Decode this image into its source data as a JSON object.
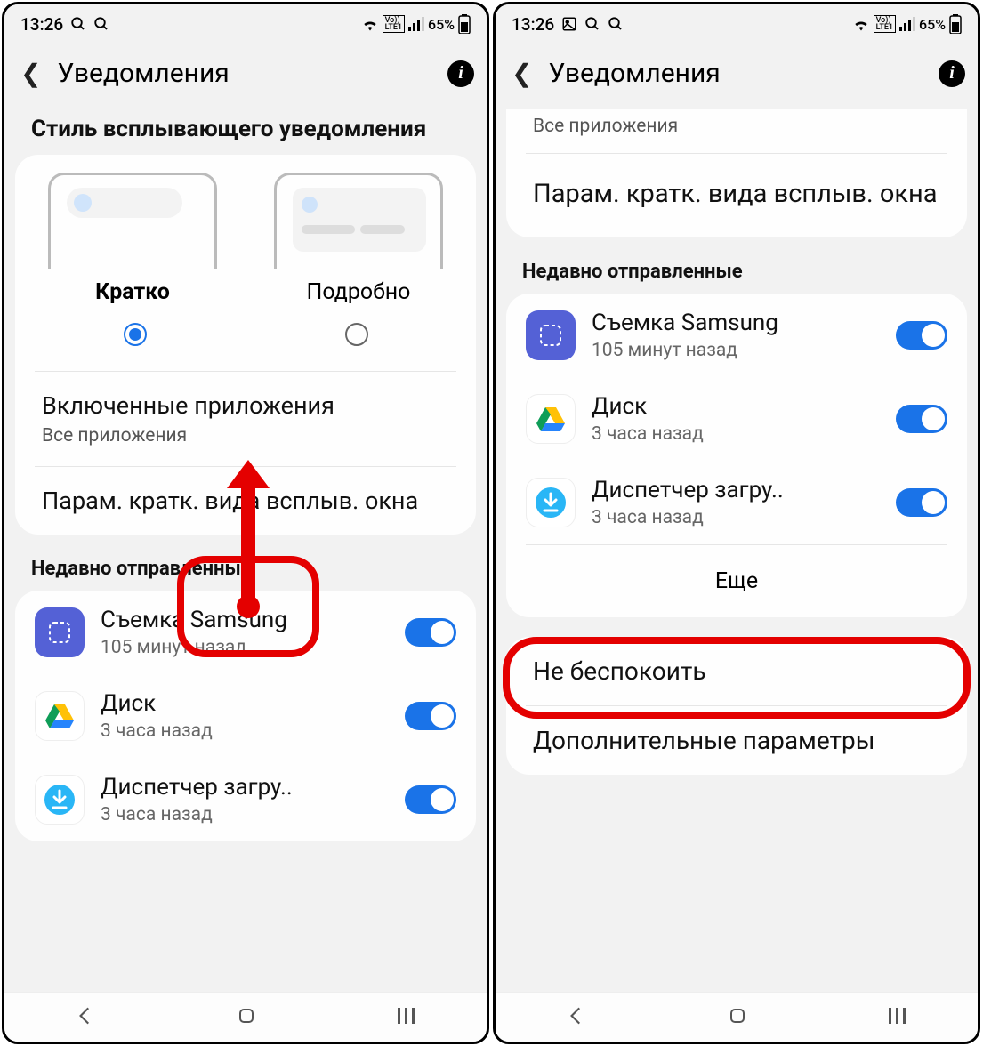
{
  "statusbar": {
    "time": "13:26",
    "battery": "65%",
    "volte": "Vo LTE",
    "gallery_icon": "gallery"
  },
  "header": {
    "title": "Уведомления"
  },
  "left": {
    "popup_style_header": "Стиль всплывающего уведомления",
    "style_options": [
      {
        "label": "Кратко",
        "selected": true
      },
      {
        "label": "Подробно",
        "selected": false
      }
    ],
    "included_apps": {
      "title": "Включенные приложения",
      "sub": "Все приложения"
    },
    "brief_settings": "Парам. кратк. вида всплыв. окна",
    "recent_header": "Недавно отправленные",
    "recent": [
      {
        "name": "Съемка Samsung",
        "time": "105 минут назад",
        "icon": "samsung",
        "on": true
      },
      {
        "name": "Диск",
        "time": "3 часа назад",
        "icon": "drive",
        "on": true
      },
      {
        "name": "Диспетчер загру..",
        "time": "3 часа назад",
        "icon": "download",
        "on": true
      }
    ]
  },
  "right": {
    "all_apps": "Все приложения",
    "brief_settings": "Парам. кратк. вида всплыв. окна",
    "recent_header": "Недавно отправленные",
    "recent": [
      {
        "name": "Съемка Samsung",
        "time": "105 минут назад",
        "icon": "samsung",
        "on": true
      },
      {
        "name": "Диск",
        "time": "3 часа назад",
        "icon": "drive",
        "on": true
      },
      {
        "name": "Диспетчер загру..",
        "time": "3 часа назад",
        "icon": "download",
        "on": true
      }
    ],
    "more": "Еще",
    "dnd": "Не беспокоить",
    "advanced": "Дополнительные параметры"
  }
}
